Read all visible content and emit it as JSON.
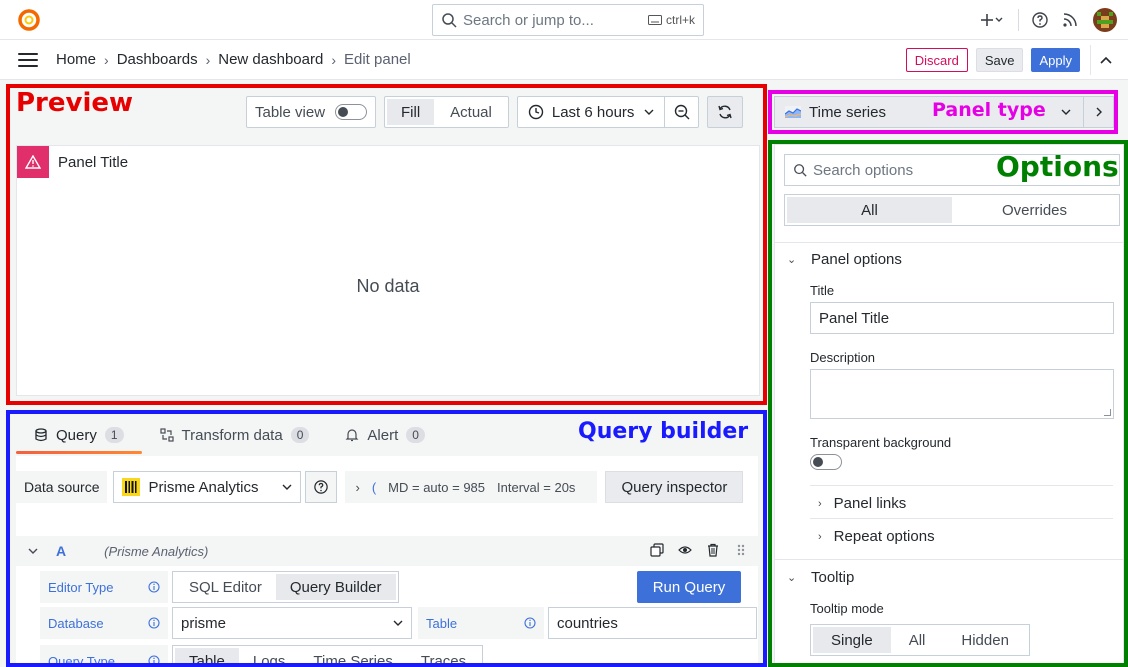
{
  "topbar": {
    "search_placeholder": "Search or jump to...",
    "shortcut": "ctrl+k"
  },
  "breadcrumbs": [
    "Home",
    "Dashboards",
    "New dashboard",
    "Edit panel"
  ],
  "actions": {
    "discard": "Discard",
    "save": "Save",
    "apply": "Apply"
  },
  "preview": {
    "table_view": "Table view",
    "fill": "Fill",
    "actual": "Actual",
    "time_range": "Last 6 hours",
    "panel_title": "Panel Title",
    "no_data": "No data"
  },
  "query": {
    "tabs": [
      {
        "label": "Query",
        "count": "1"
      },
      {
        "label": "Transform data",
        "count": "0"
      },
      {
        "label": "Alert",
        "count": "0"
      }
    ],
    "datasource_label": "Data source",
    "datasource": "Prisme Analytics",
    "md_info": "MD = auto = 985",
    "interval_info": "Interval = 20s",
    "inspector": "Query inspector",
    "ref_id": "A",
    "ref_ds": "(Prisme Analytics)",
    "editor_type_label": "Editor Type",
    "editor_types": [
      "SQL Editor",
      "Query Builder"
    ],
    "run_query": "Run Query",
    "database_label": "Database",
    "database": "prisme",
    "table_label": "Table",
    "table": "countries",
    "query_type_label": "Query Type",
    "query_types": [
      "Table",
      "Logs",
      "Time Series",
      "Traces"
    ]
  },
  "options": {
    "viz_name": "Time series",
    "search_placeholder": "Search options",
    "tab_all": "All",
    "tab_overrides": "Overrides",
    "panel_options": "Panel options",
    "title_label": "Title",
    "title_value": "Panel Title",
    "description_label": "Description",
    "transparent_label": "Transparent background",
    "panel_links": "Panel links",
    "repeat_options": "Repeat options",
    "tooltip": "Tooltip",
    "tooltip_mode_label": "Tooltip mode",
    "tooltip_modes": [
      "Single",
      "All",
      "Hidden"
    ]
  },
  "annotations": {
    "preview": "Preview",
    "query_builder": "Query builder",
    "panel_type": "Panel type",
    "options": "Options"
  },
  "colors": {
    "preview_box": "#e60000",
    "query_box": "#1a1aff",
    "panel_type_box": "#e600e6",
    "options_box": "#008000",
    "accent": "#3d71d9",
    "warning": "#e02f6a"
  }
}
